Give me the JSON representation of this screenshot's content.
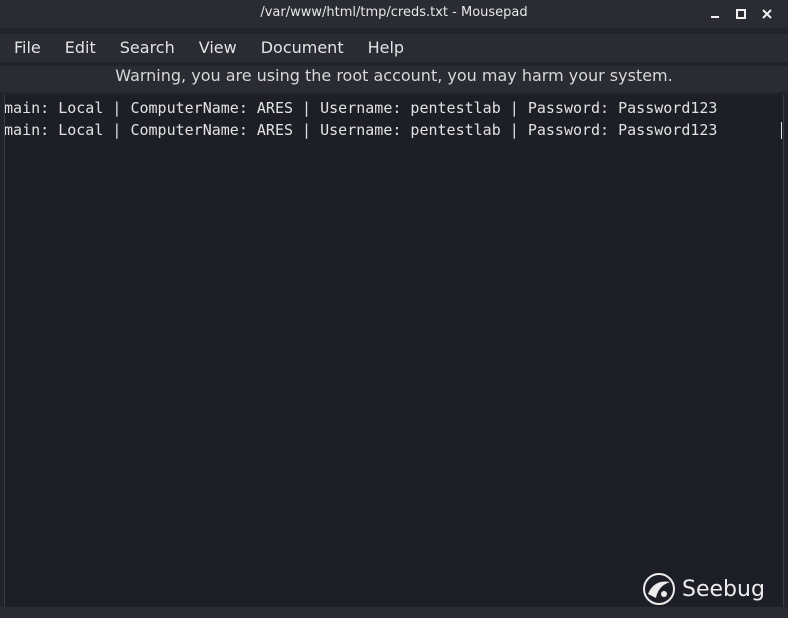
{
  "window": {
    "title": "/var/www/html/tmp/creds.txt - Mousepad"
  },
  "controls": {
    "minimize_icon": "minimize-icon",
    "maximize_icon": "maximize-icon",
    "close_icon": "close-icon"
  },
  "menubar": {
    "items": [
      {
        "label": "File"
      },
      {
        "label": "Edit"
      },
      {
        "label": "Search"
      },
      {
        "label": "View"
      },
      {
        "label": "Document"
      },
      {
        "label": "Help"
      }
    ]
  },
  "warning": {
    "text": "Warning, you are using the root account, you may harm your system."
  },
  "editor": {
    "lines": [
      "omain: Local | ComputerName: ARES | Username: pentestlab | Password: Password123",
      "omain: Local | ComputerName: ARES | Username: pentestlab | Password: Password123"
    ]
  },
  "watermark": {
    "text": "Seebug"
  },
  "colors": {
    "background": "#23242b",
    "editor_bg": "#1e1f26",
    "text": "#e2e2e2"
  }
}
